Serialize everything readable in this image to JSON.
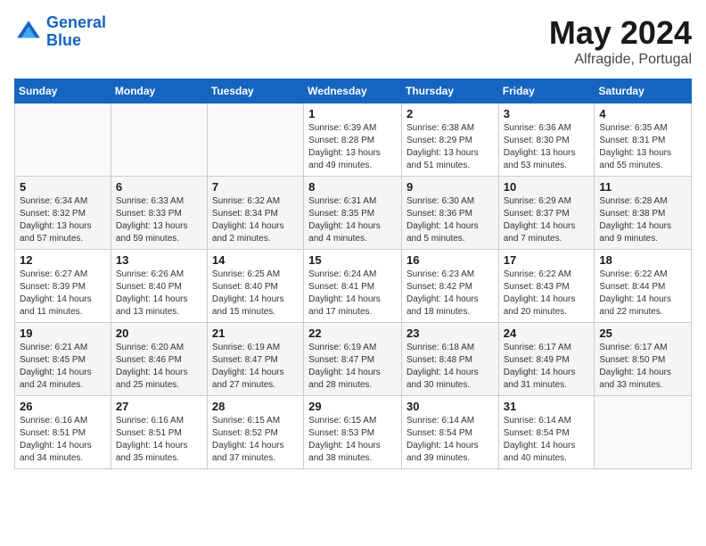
{
  "header": {
    "logo_line1": "General",
    "logo_line2": "Blue",
    "month": "May 2024",
    "location": "Alfragide, Portugal"
  },
  "calendar": {
    "days_of_week": [
      "Sunday",
      "Monday",
      "Tuesday",
      "Wednesday",
      "Thursday",
      "Friday",
      "Saturday"
    ],
    "weeks": [
      [
        {
          "day": "",
          "info": ""
        },
        {
          "day": "",
          "info": ""
        },
        {
          "day": "",
          "info": ""
        },
        {
          "day": "1",
          "info": "Sunrise: 6:39 AM\nSunset: 8:28 PM\nDaylight: 13 hours\nand 49 minutes."
        },
        {
          "day": "2",
          "info": "Sunrise: 6:38 AM\nSunset: 8:29 PM\nDaylight: 13 hours\nand 51 minutes."
        },
        {
          "day": "3",
          "info": "Sunrise: 6:36 AM\nSunset: 8:30 PM\nDaylight: 13 hours\nand 53 minutes."
        },
        {
          "day": "4",
          "info": "Sunrise: 6:35 AM\nSunset: 8:31 PM\nDaylight: 13 hours\nand 55 minutes."
        }
      ],
      [
        {
          "day": "5",
          "info": "Sunrise: 6:34 AM\nSunset: 8:32 PM\nDaylight: 13 hours\nand 57 minutes."
        },
        {
          "day": "6",
          "info": "Sunrise: 6:33 AM\nSunset: 8:33 PM\nDaylight: 13 hours\nand 59 minutes."
        },
        {
          "day": "7",
          "info": "Sunrise: 6:32 AM\nSunset: 8:34 PM\nDaylight: 14 hours\nand 2 minutes."
        },
        {
          "day": "8",
          "info": "Sunrise: 6:31 AM\nSunset: 8:35 PM\nDaylight: 14 hours\nand 4 minutes."
        },
        {
          "day": "9",
          "info": "Sunrise: 6:30 AM\nSunset: 8:36 PM\nDaylight: 14 hours\nand 5 minutes."
        },
        {
          "day": "10",
          "info": "Sunrise: 6:29 AM\nSunset: 8:37 PM\nDaylight: 14 hours\nand 7 minutes."
        },
        {
          "day": "11",
          "info": "Sunrise: 6:28 AM\nSunset: 8:38 PM\nDaylight: 14 hours\nand 9 minutes."
        }
      ],
      [
        {
          "day": "12",
          "info": "Sunrise: 6:27 AM\nSunset: 8:39 PM\nDaylight: 14 hours\nand 11 minutes."
        },
        {
          "day": "13",
          "info": "Sunrise: 6:26 AM\nSunset: 8:40 PM\nDaylight: 14 hours\nand 13 minutes."
        },
        {
          "day": "14",
          "info": "Sunrise: 6:25 AM\nSunset: 8:40 PM\nDaylight: 14 hours\nand 15 minutes."
        },
        {
          "day": "15",
          "info": "Sunrise: 6:24 AM\nSunset: 8:41 PM\nDaylight: 14 hours\nand 17 minutes."
        },
        {
          "day": "16",
          "info": "Sunrise: 6:23 AM\nSunset: 8:42 PM\nDaylight: 14 hours\nand 18 minutes."
        },
        {
          "day": "17",
          "info": "Sunrise: 6:22 AM\nSunset: 8:43 PM\nDaylight: 14 hours\nand 20 minutes."
        },
        {
          "day": "18",
          "info": "Sunrise: 6:22 AM\nSunset: 8:44 PM\nDaylight: 14 hours\nand 22 minutes."
        }
      ],
      [
        {
          "day": "19",
          "info": "Sunrise: 6:21 AM\nSunset: 8:45 PM\nDaylight: 14 hours\nand 24 minutes."
        },
        {
          "day": "20",
          "info": "Sunrise: 6:20 AM\nSunset: 8:46 PM\nDaylight: 14 hours\nand 25 minutes."
        },
        {
          "day": "21",
          "info": "Sunrise: 6:19 AM\nSunset: 8:47 PM\nDaylight: 14 hours\nand 27 minutes."
        },
        {
          "day": "22",
          "info": "Sunrise: 6:19 AM\nSunset: 8:47 PM\nDaylight: 14 hours\nand 28 minutes."
        },
        {
          "day": "23",
          "info": "Sunrise: 6:18 AM\nSunset: 8:48 PM\nDaylight: 14 hours\nand 30 minutes."
        },
        {
          "day": "24",
          "info": "Sunrise: 6:17 AM\nSunset: 8:49 PM\nDaylight: 14 hours\nand 31 minutes."
        },
        {
          "day": "25",
          "info": "Sunrise: 6:17 AM\nSunset: 8:50 PM\nDaylight: 14 hours\nand 33 minutes."
        }
      ],
      [
        {
          "day": "26",
          "info": "Sunrise: 6:16 AM\nSunset: 8:51 PM\nDaylight: 14 hours\nand 34 minutes."
        },
        {
          "day": "27",
          "info": "Sunrise: 6:16 AM\nSunset: 8:51 PM\nDaylight: 14 hours\nand 35 minutes."
        },
        {
          "day": "28",
          "info": "Sunrise: 6:15 AM\nSunset: 8:52 PM\nDaylight: 14 hours\nand 37 minutes."
        },
        {
          "day": "29",
          "info": "Sunrise: 6:15 AM\nSunset: 8:53 PM\nDaylight: 14 hours\nand 38 minutes."
        },
        {
          "day": "30",
          "info": "Sunrise: 6:14 AM\nSunset: 8:54 PM\nDaylight: 14 hours\nand 39 minutes."
        },
        {
          "day": "31",
          "info": "Sunrise: 6:14 AM\nSunset: 8:54 PM\nDaylight: 14 hours\nand 40 minutes."
        },
        {
          "day": "",
          "info": ""
        }
      ]
    ]
  }
}
